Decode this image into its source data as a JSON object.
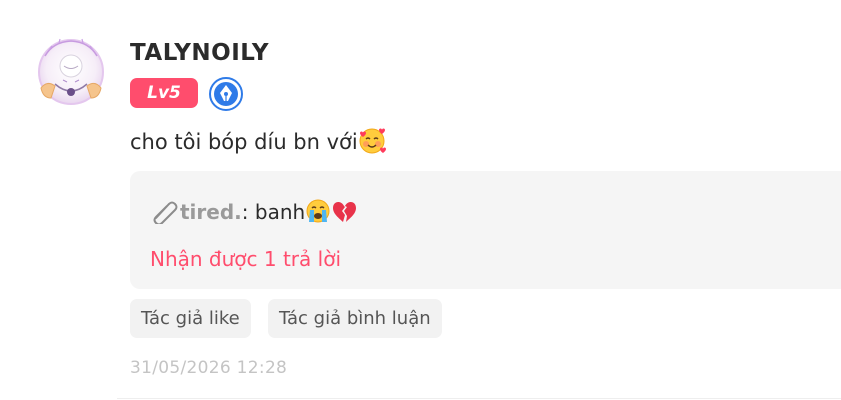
{
  "user": {
    "name": "TALYNOILY",
    "level": "Lv5",
    "avatar_icon": "avatar-illustration",
    "badge_icon": "pen-nib-badge-icon"
  },
  "comment": {
    "text": "cho tôi bóp díu bn với",
    "emoji_icon": "smiling-face-with-hearts-emoji"
  },
  "reply": {
    "author": "tired.",
    "colon": ": ",
    "text": "banh",
    "emojis": [
      "loudly-crying-face-emoji",
      "broken-heart-emoji"
    ],
    "count_label": "Nhận được 1 trả lời"
  },
  "tags": [
    "Tác giả like",
    "Tác giả bình luận"
  ],
  "timestamp": "31/05/2026 12:28",
  "colors": {
    "accent": "#ff4d6d",
    "badge_blue": "#2f7be8",
    "muted_text": "#9a9a9a",
    "timestamp": "#c4c4c4"
  }
}
